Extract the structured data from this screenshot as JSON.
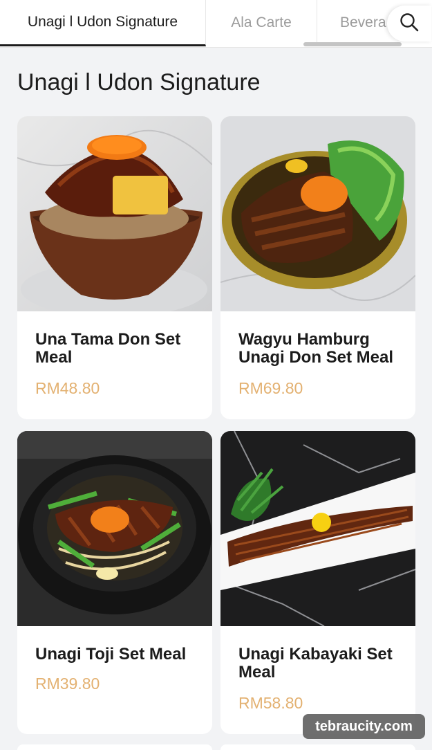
{
  "tabs": [
    {
      "label": "Unagi l Udon Signature"
    },
    {
      "label": "Ala Carte"
    },
    {
      "label": "Bevera"
    }
  ],
  "search": {
    "icon": "search-icon"
  },
  "section": {
    "title": "Unagi l Udon Signature"
  },
  "items": [
    {
      "name": "Una Tama Don Set Meal",
      "price": "RM48.80"
    },
    {
      "name": "Wagyu Hamburg Unagi Don Set Meal",
      "price": "RM69.80"
    },
    {
      "name": "Unagi Toji Set Meal",
      "price": "RM39.80"
    },
    {
      "name": "Unagi Kabayaki Set Meal",
      "price": "RM58.80"
    }
  ],
  "watermark": "tebraucity.com",
  "colors": {
    "price": "#e3b171",
    "active_tab": "#1c1c1c",
    "background": "#f2f3f5"
  }
}
